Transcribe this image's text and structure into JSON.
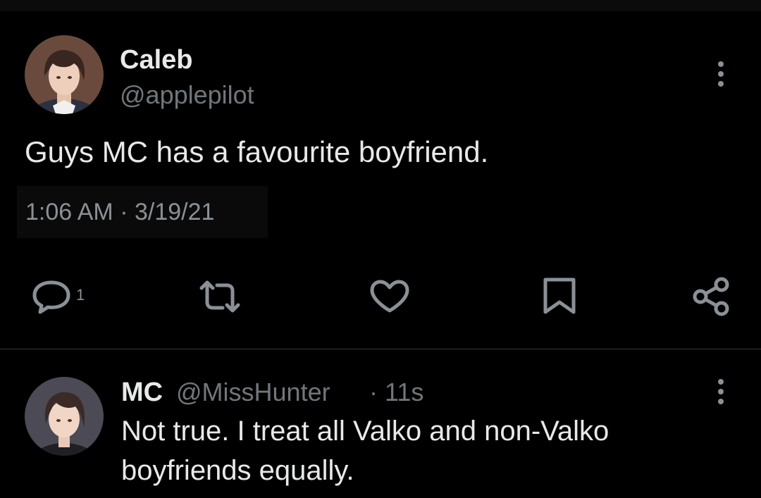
{
  "tweet": {
    "author_name": "Caleb",
    "author_handle": "@applepilot",
    "text": "Guys MC has a favourite boyfriend.",
    "timestamp": "1:06 AM · 3/19/21",
    "actions": {
      "reply_count": "1"
    }
  },
  "reply": {
    "author_name": "MC",
    "author_handle": "@MissHunter",
    "time": "· 11s",
    "text_line1": "Not true. I treat all Valko and non-Valko",
    "text_line2": "boyfriends equally."
  },
  "icons": {
    "more": "more-vertical-icon",
    "reply": "reply-bubble-icon",
    "retweet": "retweet-icon",
    "like": "heart-icon",
    "bookmark": "bookmark-icon",
    "share": "share-icon"
  },
  "colors": {
    "background": "#000000",
    "text_primary": "#e7e9ea",
    "text_secondary": "#71767b",
    "icon": "#8b9097",
    "divider": "#2f3336"
  }
}
